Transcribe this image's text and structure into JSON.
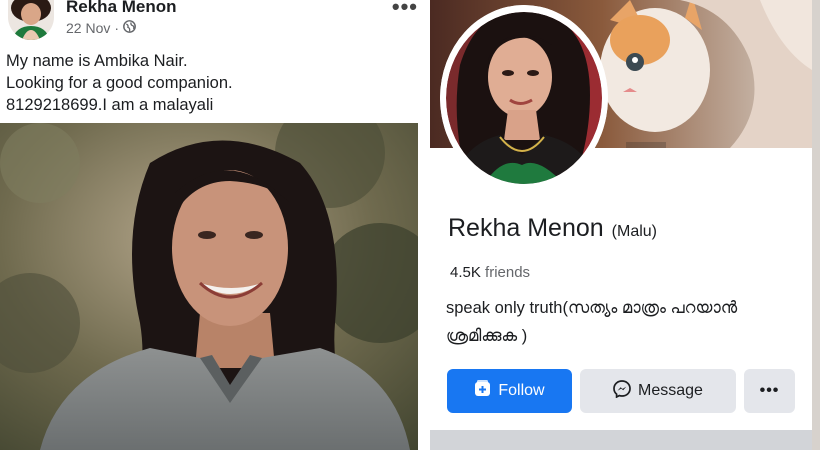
{
  "post": {
    "author": "Rekha Menon",
    "date": "22 Nov",
    "date_separator": "·",
    "privacy_icon": "globe-icon",
    "more_label": "•••",
    "text_lines": [
      "My name is Ambika Nair.",
      "Looking for a good companion.",
      "8129218699.I am a malayali"
    ]
  },
  "profile": {
    "name": "Rekha Menon",
    "nickname": "(Malu)",
    "friends_count": "4.5K",
    "friends_label": "friends",
    "bio_lines": [
      "speak only truth(സത്യം മാത്രം പറയാൻ",
      "ശ്രമിക്കുക )"
    ],
    "buttons": {
      "follow_label": "Follow",
      "message_label": "Message",
      "more_label": "•••"
    }
  },
  "colors": {
    "follow_button": "#1877f2",
    "secondary_button": "#e4e6eb",
    "meta_text": "#65676b",
    "primary_text": "#1c1e21"
  }
}
